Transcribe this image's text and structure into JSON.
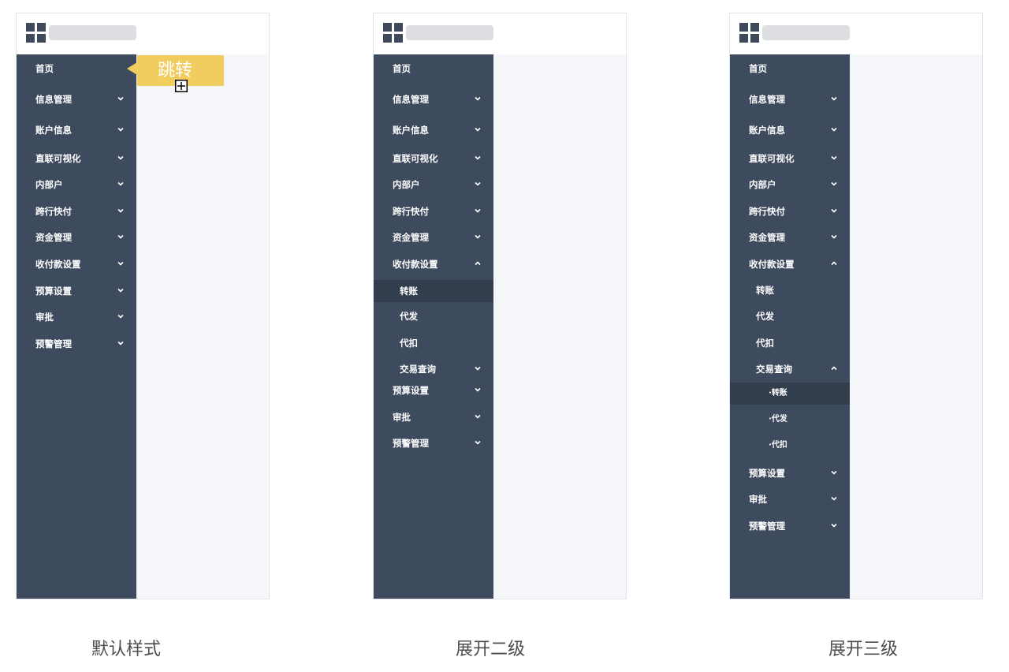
{
  "panels": {
    "default": {
      "caption": "默认样式",
      "tooltip": "跳转",
      "menu": [
        "首页",
        "信息管理",
        "账户信息",
        "直联可视化",
        "内部户",
        "跨行快付",
        "资金管理",
        "收付款设置",
        "预算设置",
        "审批",
        "预警管理"
      ]
    },
    "second": {
      "caption": "展开二级",
      "menu": [
        "首页",
        "信息管理",
        "账户信息",
        "直联可视化",
        "内部户",
        "跨行快付",
        "资金管理",
        "收付款设置"
      ],
      "submenu": [
        "转账",
        "代发",
        "代扣",
        "交易查询"
      ],
      "after": [
        "预算设置",
        "审批",
        "预警管理"
      ]
    },
    "third": {
      "caption": "展开三级",
      "menu": [
        "首页",
        "信息管理",
        "账户信息",
        "直联可视化",
        "内部户",
        "跨行快付",
        "资金管理",
        "收付款设置"
      ],
      "submenu": [
        "转账",
        "代发",
        "代扣",
        "交易查询"
      ],
      "thirdmenu": [
        "·转账",
        "·代发",
        "·代扣"
      ],
      "after": [
        "预算设置",
        "审批",
        "预警管理"
      ]
    }
  },
  "icons": {
    "expand": "chevron-down-icon",
    "collapse": "chevron-up-icon",
    "logo": "grid-logo-icon",
    "cursor": "crosshair-cursor-icon"
  },
  "colors": {
    "sidebar": "#3e4b5e",
    "active": "#323d4d",
    "content": "#f5f6fa",
    "tooltip": "#f1cd60"
  }
}
